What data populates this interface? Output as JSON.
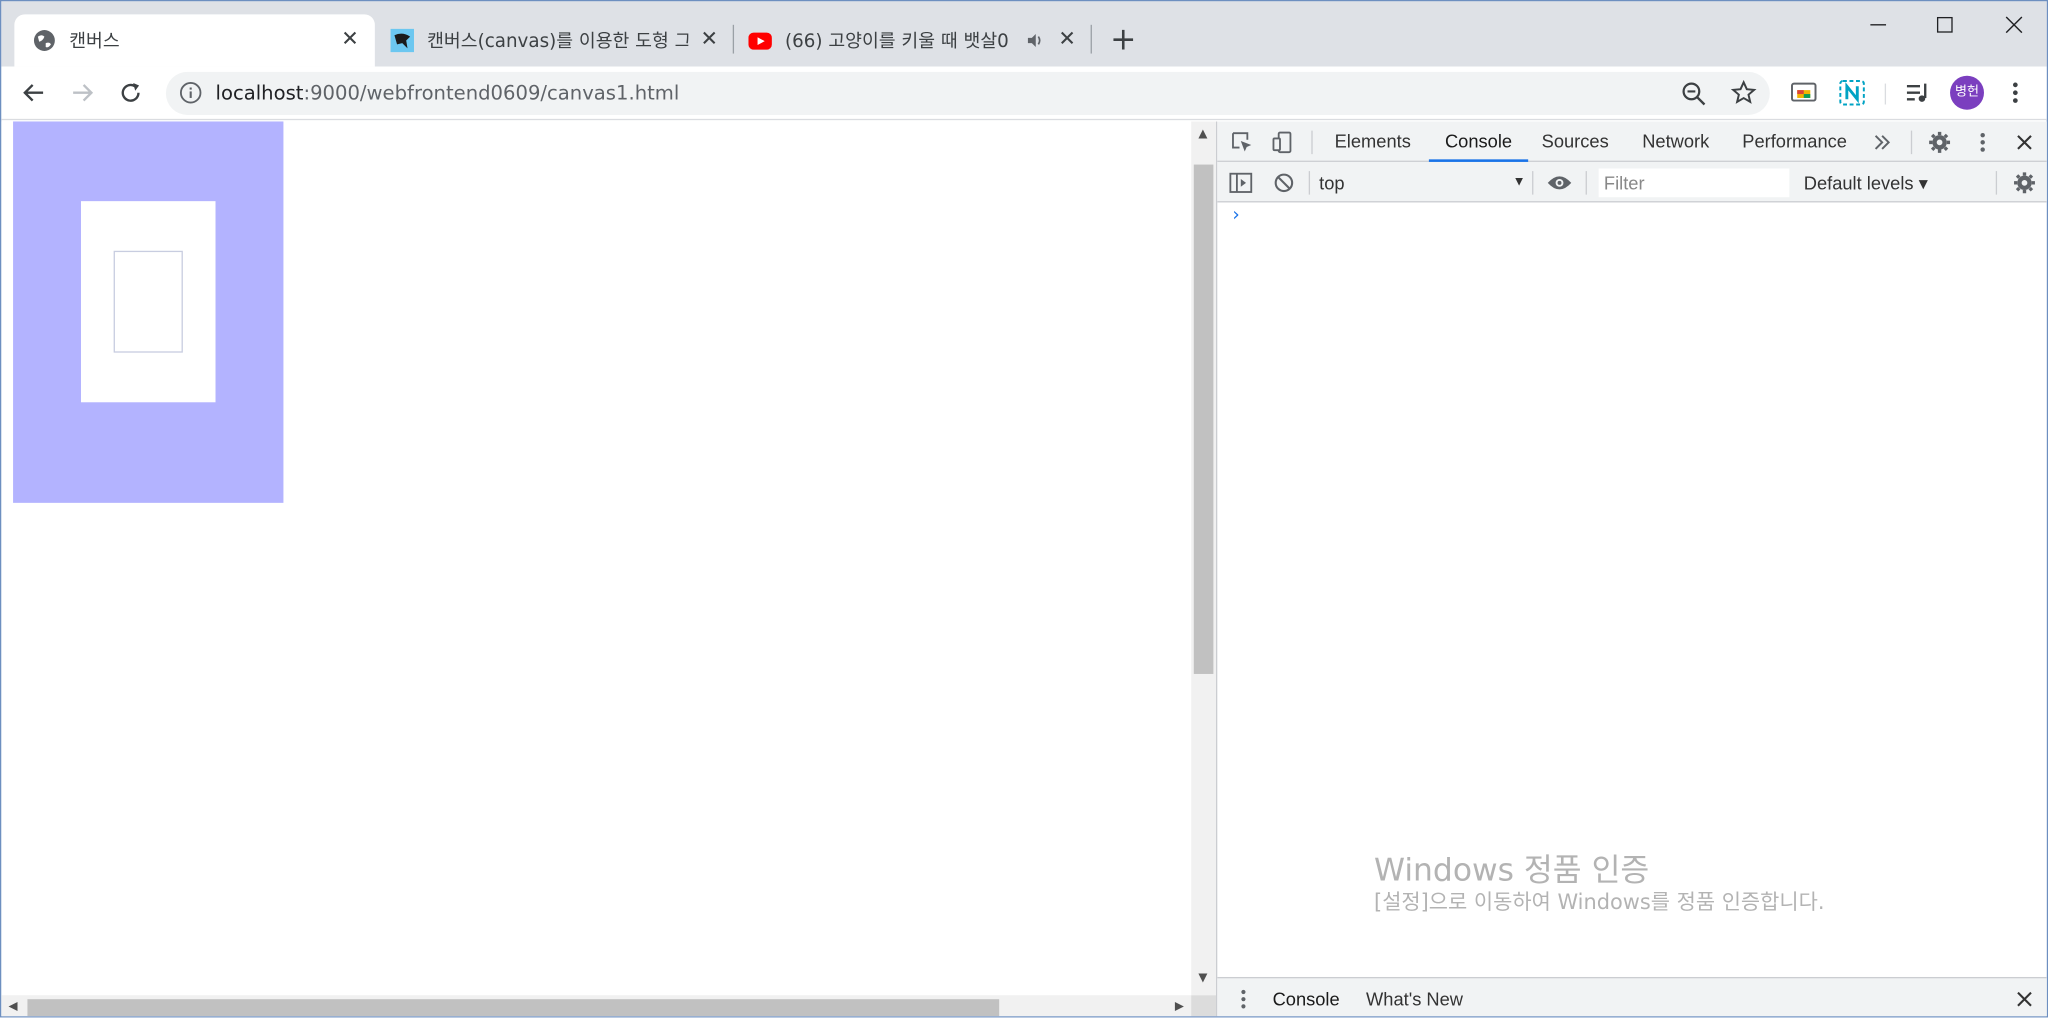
{
  "browser": {
    "tabs": [
      {
        "title": "캔버스",
        "icon": "globe-icon",
        "active": true
      },
      {
        "title": "캔버스(canvas)를 이용한 도형 그",
        "icon": "site-favicon"
      },
      {
        "title": "(66) 고양이를 키울 때 뱃살0",
        "icon": "youtube-icon",
        "audio": "speaker-icon"
      }
    ],
    "new_tab_label": "+",
    "close_glyph": "✕"
  },
  "toolbar": {
    "url_host": "localhost",
    "url_rest": ":9000/webfrontend0609/canvas1.html",
    "avatar_text": "병헌"
  },
  "devtools": {
    "tabs": [
      "Elements",
      "Console",
      "Sources",
      "Network",
      "Performance"
    ],
    "active_tab": "Console",
    "context": "top",
    "filter_placeholder": "Filter",
    "levels": "Default levels ▾",
    "prompt": "›",
    "drawer_tabs": [
      "Console",
      "What's New"
    ]
  },
  "watermark": {
    "line1": "Windows 정품 인증",
    "line2": "[설정]으로 이동하여 Windows를 정품 인증합니다."
  },
  "colors": {
    "canvas_fill": "#b3b3ff",
    "accent": "#1a73e8"
  }
}
